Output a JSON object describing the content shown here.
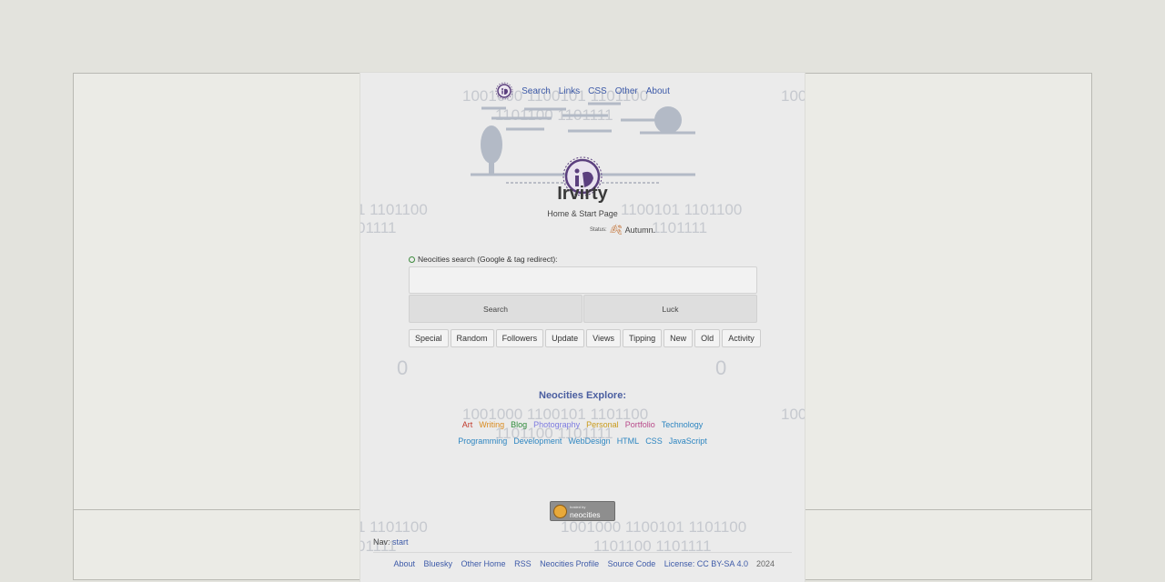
{
  "nav": {
    "items": [
      "Search",
      "Links",
      "CSS",
      "Other",
      "About"
    ]
  },
  "site": {
    "title": "Irvirty",
    "subtitle": "Home & Start Page",
    "status_label": "Status:",
    "status_value": "Autumn."
  },
  "search": {
    "label": "Neocities search (Google & tag redirect):",
    "input_value": "",
    "buttons": [
      "Search",
      "Luck"
    ],
    "tags": [
      "Special",
      "Random",
      "Followers",
      "Update",
      "Views",
      "Tipping",
      "New",
      "Old",
      "Activity"
    ]
  },
  "explore": {
    "title": "Neocities Explore:",
    "row1": [
      {
        "label": "Art",
        "color": "#c0392b"
      },
      {
        "label": "Writing",
        "color": "#d98a1e"
      },
      {
        "label": "Blog",
        "color": "#2e8b3a"
      },
      {
        "label": "Photography",
        "color": "#7d7be0"
      },
      {
        "label": "Personal",
        "color": "#c99a1a"
      },
      {
        "label": "Portfolio",
        "color": "#b84a8a"
      },
      {
        "label": "Technology",
        "color": "#2e86c1"
      }
    ],
    "row2": [
      {
        "label": "Programming",
        "color": "#2e86c1"
      },
      {
        "label": "Development",
        "color": "#2e86c1"
      },
      {
        "label": "WebDesign",
        "color": "#2e86c1"
      },
      {
        "label": "HTML",
        "color": "#2e86c1"
      },
      {
        "label": "CSS",
        "color": "#2e86c1"
      },
      {
        "label": "JavaScript",
        "color": "#2e86c1"
      }
    ]
  },
  "badge": {
    "small_text": "hosted by",
    "text": "neocities"
  },
  "bottom_nav": {
    "label": "Nav:",
    "link": "start"
  },
  "footer": {
    "links": [
      "About",
      "Bluesky",
      "Other Home",
      "RSS",
      "Neocities Profile",
      "Source Code",
      "License: CC BY-SA 4.0"
    ],
    "year": "2024"
  },
  "background_binary": {
    "a": "1001000 1100101 1101100",
    "b": "1101100 1101111",
    "c": "1 1101100",
    "d": "01111",
    "e": "1100101 1101100",
    "f": "1101111",
    "g": "0",
    "h": "100"
  },
  "colors": {
    "link": "#3d5aa8",
    "accent_purple": "#5b3f7e"
  }
}
